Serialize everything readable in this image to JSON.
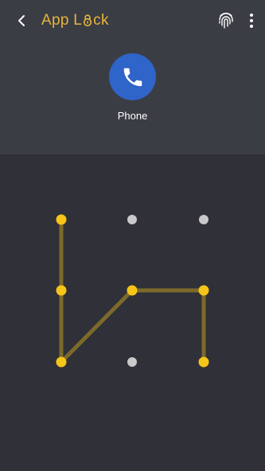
{
  "header": {
    "title_part1": "App L",
    "title_part2": "ck"
  },
  "locked_app": {
    "name": "Phone",
    "icon": "phone-icon",
    "icon_color": "#2f64c8"
  },
  "pattern": {
    "grid": "3x3",
    "selected_dots": [
      1,
      4,
      7,
      5,
      6,
      9
    ],
    "path_order": [
      1,
      4,
      7,
      5,
      6,
      9
    ],
    "active_color": "#f5c518",
    "line_color": "#7d6a2a",
    "inactive_color": "#c9c9c9"
  },
  "colors": {
    "accent": "#e7b53b",
    "background": "#2f3038",
    "header_background": "#3b3d45"
  }
}
